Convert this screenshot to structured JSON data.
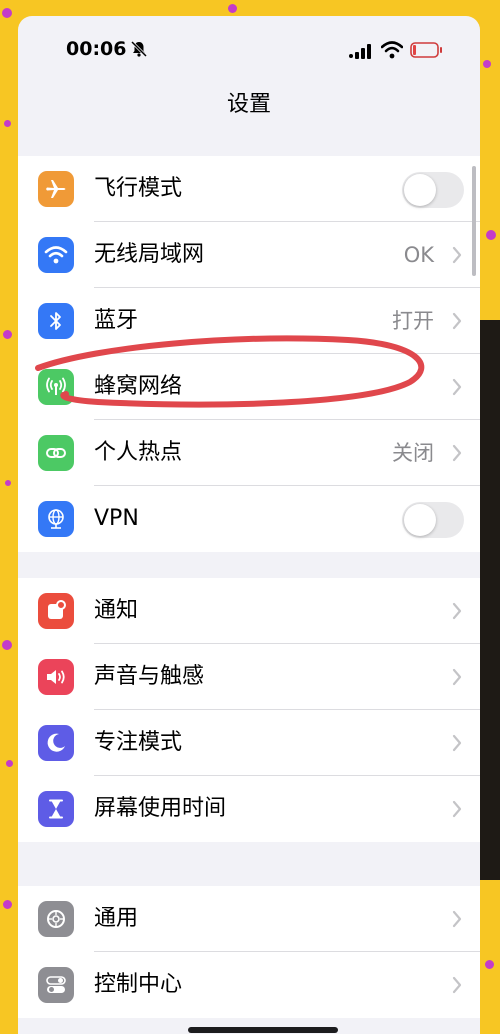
{
  "status": {
    "time": "00:06"
  },
  "nav": {
    "title": "设置"
  },
  "group1": [
    {
      "label": "飞行模式",
      "icon": "airplane-icon",
      "color": "#f09a37",
      "type": "toggle",
      "on": false
    },
    {
      "label": "无线局域网",
      "icon": "wifi-icon",
      "color": "#3478f6",
      "type": "value",
      "value": "OK"
    },
    {
      "label": "蓝牙",
      "icon": "bluetooth-icon",
      "color": "#3478f6",
      "type": "value",
      "value": "打开"
    },
    {
      "label": "蜂窝网络",
      "icon": "cellular-antenna-icon",
      "color": "#4cc964",
      "type": "chevron"
    },
    {
      "label": "个人热点",
      "icon": "hotspot-link-icon",
      "color": "#4cc964",
      "type": "value",
      "value": "关闭"
    },
    {
      "label": "VPN",
      "icon": "globe-icon",
      "color": "#3478f6",
      "type": "toggle",
      "on": false
    }
  ],
  "group2": [
    {
      "label": "通知",
      "icon": "notification-bell-icon",
      "color": "#eb4d3d",
      "type": "chevron"
    },
    {
      "label": "声音与触感",
      "icon": "speaker-icon",
      "color": "#eb445a",
      "type": "chevron"
    },
    {
      "label": "专注模式",
      "icon": "moon-icon",
      "color": "#5e5ce6",
      "type": "chevron"
    },
    {
      "label": "屏幕使用时间",
      "icon": "hourglass-icon",
      "color": "#5e5ce6",
      "type": "chevron"
    }
  ],
  "group3": [
    {
      "label": "通用",
      "icon": "gear-icon",
      "color": "#8e8e93",
      "type": "chevron"
    },
    {
      "label": "控制中心",
      "icon": "switches-icon",
      "color": "#8e8e93",
      "type": "chevron"
    }
  ],
  "annotation": {
    "color": "#e0474c"
  }
}
